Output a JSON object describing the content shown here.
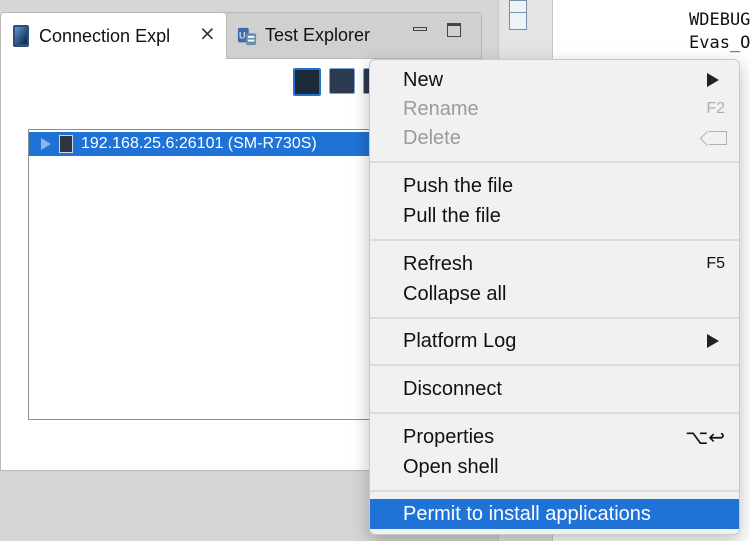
{
  "tabs": [
    {
      "label": "Connection Expl",
      "active": true,
      "icon": "device-icon"
    },
    {
      "label": "Test Explorer",
      "active": false,
      "icon": "test-explorer-icon"
    }
  ],
  "tree": {
    "items": [
      {
        "label": "192.168.25.6:26101 (SM-R730S)",
        "selected": true,
        "expanded": false,
        "icon": "device-icon"
      }
    ]
  },
  "editor": {
    "lines": [
      "WDEBUG",
      "Evas_O"
    ]
  },
  "context_menu": {
    "groups": [
      [
        {
          "label": "New",
          "submenu": true,
          "enabled": true
        },
        {
          "label": "Rename",
          "shortcut": "F2",
          "enabled": false
        },
        {
          "label": "Delete",
          "shortcut_icon": "delete-key-icon",
          "enabled": false
        }
      ],
      [
        {
          "label": "Push the file",
          "enabled": true
        },
        {
          "label": "Pull the file",
          "enabled": true
        }
      ],
      [
        {
          "label": "Refresh",
          "shortcut": "F5",
          "enabled": true
        },
        {
          "label": "Collapse all",
          "enabled": true
        }
      ],
      [
        {
          "label": "Platform Log",
          "submenu": true,
          "enabled": true
        }
      ],
      [
        {
          "label": "Disconnect",
          "enabled": true
        }
      ],
      [
        {
          "label": "Properties",
          "shortcut": "⌥↩",
          "enabled": true
        },
        {
          "label": "Open shell",
          "enabled": true
        }
      ],
      [
        {
          "label": "Permit to install applications",
          "enabled": true,
          "highlighted": true
        }
      ]
    ]
  },
  "colors": {
    "selection": "#1f72d6",
    "menu_bg": "#f1f1f1",
    "disabled_text": "#9a9a9a"
  }
}
